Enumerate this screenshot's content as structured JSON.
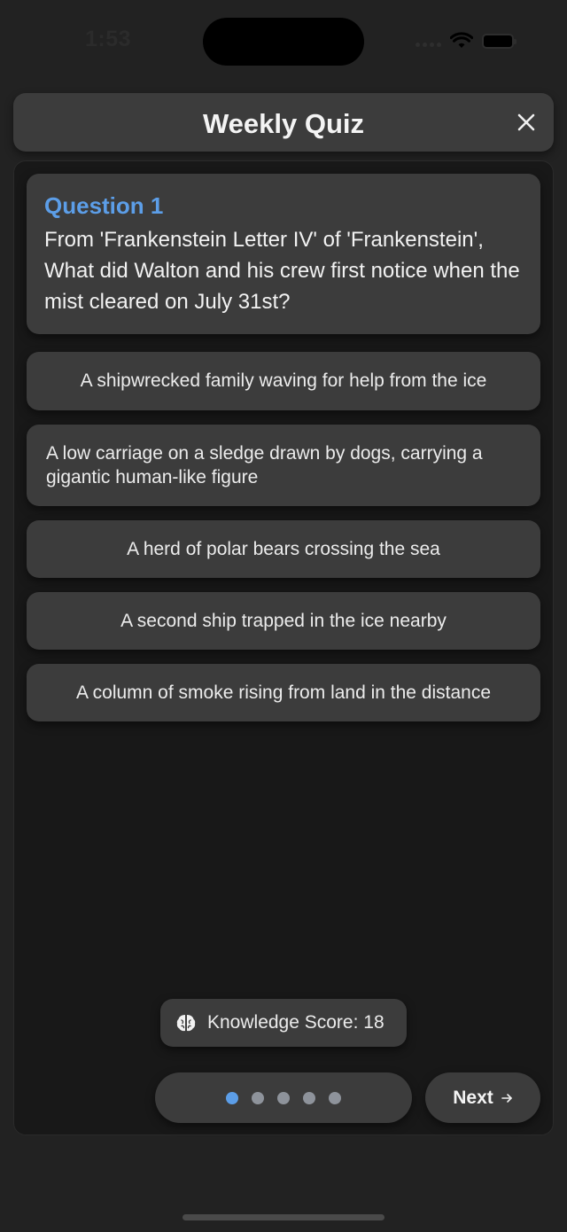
{
  "status_bar": {
    "time": "1:53"
  },
  "header": {
    "title": "Weekly Quiz",
    "close_icon": "close-icon"
  },
  "question": {
    "number_label": "Question 1",
    "text": "From 'Frankenstein Letter IV' of 'Frankenstein', What did Walton and his crew first notice when the mist cleared on July 31st?"
  },
  "answers": [
    {
      "label": "A shipwrecked family waving for help from the ice"
    },
    {
      "label": "A low carriage on a sledge drawn by dogs, carrying a gigantic human-like figure"
    },
    {
      "label": "A herd of polar bears crossing the sea"
    },
    {
      "label": "A second ship trapped in the ice nearby"
    },
    {
      "label": "A column of smoke rising from land in the distance"
    }
  ],
  "score": {
    "icon": "brain-icon",
    "label": "Knowledge Score: 18"
  },
  "pagination": {
    "total": 5,
    "current": 1
  },
  "footer": {
    "next_label": "Next",
    "next_icon": "arrow-right-icon"
  },
  "colors": {
    "accent": "#5c9ee8",
    "card": "#3c3c3c",
    "background": "#222222",
    "panel": "#181818"
  }
}
